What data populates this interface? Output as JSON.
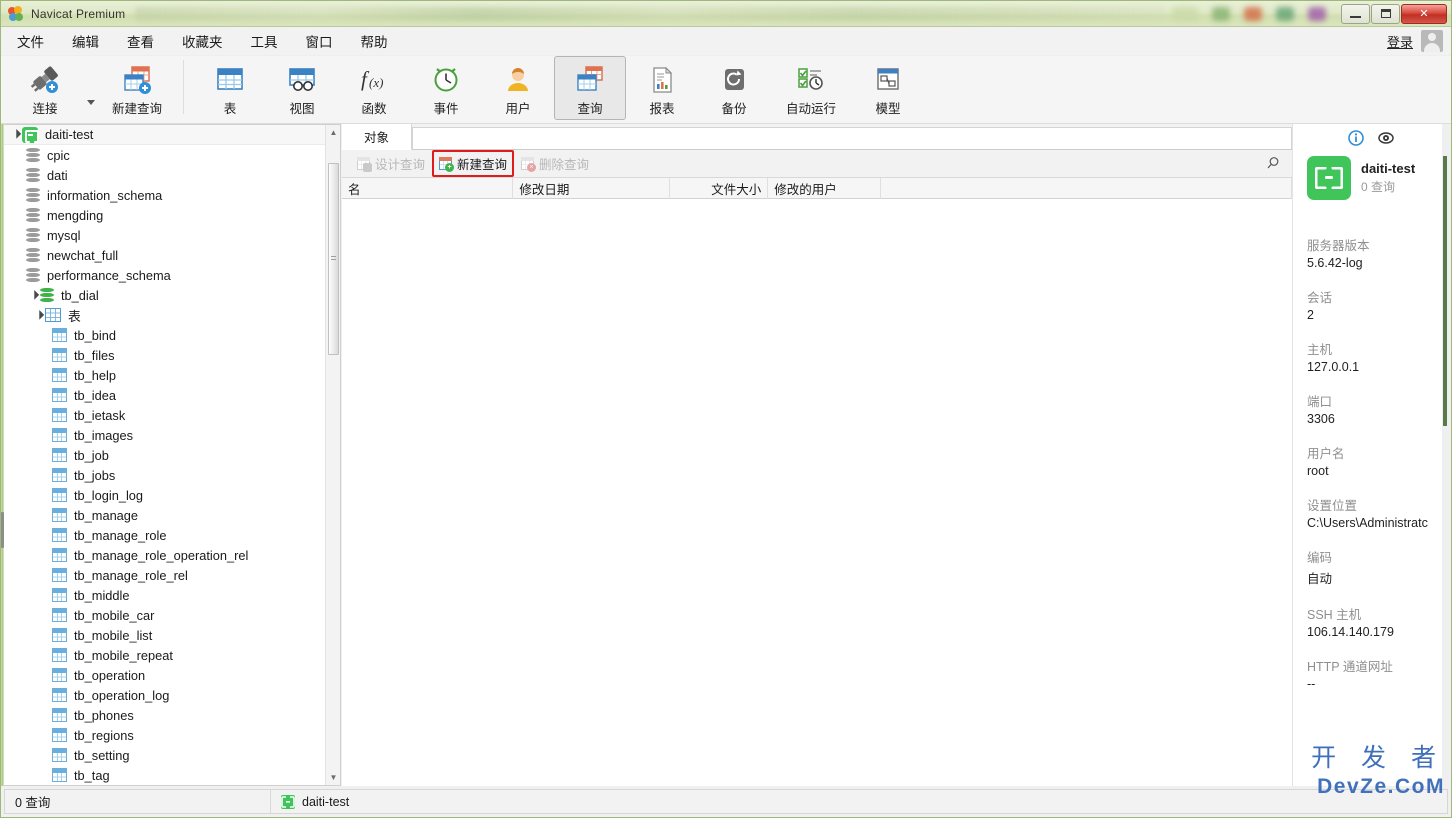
{
  "window": {
    "title": "Navicat Premium",
    "app_icon": "navicat-logo-icon",
    "minimize_label": "",
    "maximize_label": "",
    "close_label": "✕"
  },
  "menubar": {
    "items": [
      {
        "label": "文件",
        "name": "menu-file"
      },
      {
        "label": "编辑",
        "name": "menu-edit"
      },
      {
        "label": "查看",
        "name": "menu-view"
      },
      {
        "label": "收藏夹",
        "name": "menu-favorites"
      },
      {
        "label": "工具",
        "name": "menu-tools"
      },
      {
        "label": "窗口",
        "name": "menu-window"
      },
      {
        "label": "帮助",
        "name": "menu-help"
      }
    ],
    "login_label": "登录"
  },
  "toolbar": {
    "items": [
      {
        "label": "连接",
        "icon": "connection-plug-icon",
        "selected": false
      },
      {
        "label": "新建查询",
        "icon": "new-query-icon",
        "selected": false
      },
      {
        "label": "表",
        "icon": "table-icon",
        "selected": false
      },
      {
        "label": "视图",
        "icon": "view-icon",
        "selected": false
      },
      {
        "label": "函数",
        "icon": "function-fx-icon",
        "selected": false
      },
      {
        "label": "事件",
        "icon": "event-clock-icon",
        "selected": false
      },
      {
        "label": "用户",
        "icon": "user-icon",
        "selected": false
      },
      {
        "label": "查询",
        "icon": "query-calendar-grid-icon",
        "selected": true
      },
      {
        "label": "报表",
        "icon": "report-document-icon",
        "selected": false
      },
      {
        "label": "备份",
        "icon": "backup-disk-icon",
        "selected": false
      },
      {
        "label": "自动运行",
        "icon": "automation-schedule-icon",
        "selected": false
      },
      {
        "label": "模型",
        "icon": "model-diagram-icon",
        "selected": false
      }
    ]
  },
  "sidebar": {
    "nodes": [
      {
        "label": "daiti-test",
        "level": 0,
        "icon": "connection-icon",
        "expanded": true,
        "type": "connection"
      },
      {
        "label": "cpic",
        "level": 1,
        "icon": "database-icon",
        "type": "database"
      },
      {
        "label": "dati",
        "level": 1,
        "icon": "database-icon",
        "type": "database"
      },
      {
        "label": "information_schema",
        "level": 1,
        "icon": "database-icon",
        "type": "database"
      },
      {
        "label": "mengding",
        "level": 1,
        "icon": "database-icon",
        "type": "database"
      },
      {
        "label": "mysql",
        "level": 1,
        "icon": "database-icon",
        "type": "database"
      },
      {
        "label": "newchat_full",
        "level": 1,
        "icon": "database-icon",
        "type": "database"
      },
      {
        "label": "performance_schema",
        "level": 1,
        "icon": "database-icon",
        "type": "database"
      },
      {
        "label": "tb_dial",
        "level": 1,
        "icon": "database-open-icon",
        "expanded": true,
        "type": "database-open"
      },
      {
        "label": "表",
        "level": 2,
        "icon": "tables-folder-icon",
        "expanded": true,
        "type": "folder"
      },
      {
        "label": "tb_bind",
        "level": 3,
        "icon": "table-icon",
        "type": "table"
      },
      {
        "label": "tb_files",
        "level": 3,
        "icon": "table-icon",
        "type": "table"
      },
      {
        "label": "tb_help",
        "level": 3,
        "icon": "table-icon",
        "type": "table"
      },
      {
        "label": "tb_idea",
        "level": 3,
        "icon": "table-icon",
        "type": "table"
      },
      {
        "label": "tb_ietask",
        "level": 3,
        "icon": "table-icon",
        "type": "table"
      },
      {
        "label": "tb_images",
        "level": 3,
        "icon": "table-icon",
        "type": "table"
      },
      {
        "label": "tb_job",
        "level": 3,
        "icon": "table-icon",
        "type": "table"
      },
      {
        "label": "tb_jobs",
        "level": 3,
        "icon": "table-icon",
        "type": "table"
      },
      {
        "label": "tb_login_log",
        "level": 3,
        "icon": "table-icon",
        "type": "table"
      },
      {
        "label": "tb_manage",
        "level": 3,
        "icon": "table-icon",
        "type": "table"
      },
      {
        "label": "tb_manage_role",
        "level": 3,
        "icon": "table-icon",
        "type": "table"
      },
      {
        "label": "tb_manage_role_operation_rel",
        "level": 3,
        "icon": "table-icon",
        "type": "table"
      },
      {
        "label": "tb_manage_role_rel",
        "level": 3,
        "icon": "table-icon",
        "type": "table"
      },
      {
        "label": "tb_middle",
        "level": 3,
        "icon": "table-icon",
        "type": "table"
      },
      {
        "label": "tb_mobile_car",
        "level": 3,
        "icon": "table-icon",
        "type": "table"
      },
      {
        "label": "tb_mobile_list",
        "level": 3,
        "icon": "table-icon",
        "type": "table"
      },
      {
        "label": "tb_mobile_repeat",
        "level": 3,
        "icon": "table-icon",
        "type": "table"
      },
      {
        "label": "tb_operation",
        "level": 3,
        "icon": "table-icon",
        "type": "table"
      },
      {
        "label": "tb_operation_log",
        "level": 3,
        "icon": "table-icon",
        "type": "table"
      },
      {
        "label": "tb_phones",
        "level": 3,
        "icon": "table-icon",
        "type": "table"
      },
      {
        "label": "tb_regions",
        "level": 3,
        "icon": "table-icon",
        "type": "table"
      },
      {
        "label": "tb_setting",
        "level": 3,
        "icon": "table-icon",
        "type": "table"
      },
      {
        "label": "tb_tag",
        "level": 3,
        "icon": "table-icon",
        "type": "table"
      }
    ]
  },
  "center": {
    "tabs": [
      {
        "label": "对象",
        "active": true
      }
    ],
    "object_bar": {
      "design_query": {
        "label": "设计查询",
        "enabled": false,
        "icon": "design-query-icon"
      },
      "new_query": {
        "label": "新建查询",
        "enabled": true,
        "highlighted": true,
        "icon": "new-query-icon"
      },
      "delete_query": {
        "label": "删除查询",
        "enabled": false,
        "icon": "delete-query-icon"
      },
      "search_icon": "search-icon"
    },
    "columns": [
      {
        "label": "名",
        "align": "left"
      },
      {
        "label": "修改日期",
        "align": "left"
      },
      {
        "label": "文件大小",
        "align": "right"
      },
      {
        "label": "修改的用户",
        "align": "left"
      },
      {
        "label": "",
        "align": "left"
      }
    ],
    "rows": []
  },
  "info_panel": {
    "info_icon": "info-circle-icon",
    "eye_icon": "eye-icon",
    "connection_name": "daiti-test",
    "connection_sub": "0 查询",
    "fields": [
      {
        "key": "服务器版本",
        "value": "5.6.42-log"
      },
      {
        "key": "会话",
        "value": "2"
      },
      {
        "key": "主机",
        "value": "127.0.0.1"
      },
      {
        "key": "端口",
        "value": "3306"
      },
      {
        "key": "用户名",
        "value": "root"
      },
      {
        "key": "设置位置",
        "value": "C:\\Users\\Administratc"
      },
      {
        "key": "编码",
        "value": "自动"
      },
      {
        "key": "SSH 主机",
        "value": "106.14.140.179"
      },
      {
        "key": "HTTP 通道网址",
        "value": "--"
      }
    ]
  },
  "statusbar": {
    "left": "0 查询",
    "connection": "daiti-test"
  },
  "watermark": {
    "line1": "开 发 者",
    "line2": "DevZe.CoM"
  },
  "colors": {
    "accent_green": "#3fc55a",
    "highlight_red": "#e01b1b",
    "title_gradient": "#d2dfb0",
    "watermark_blue": "#2f63b5"
  }
}
